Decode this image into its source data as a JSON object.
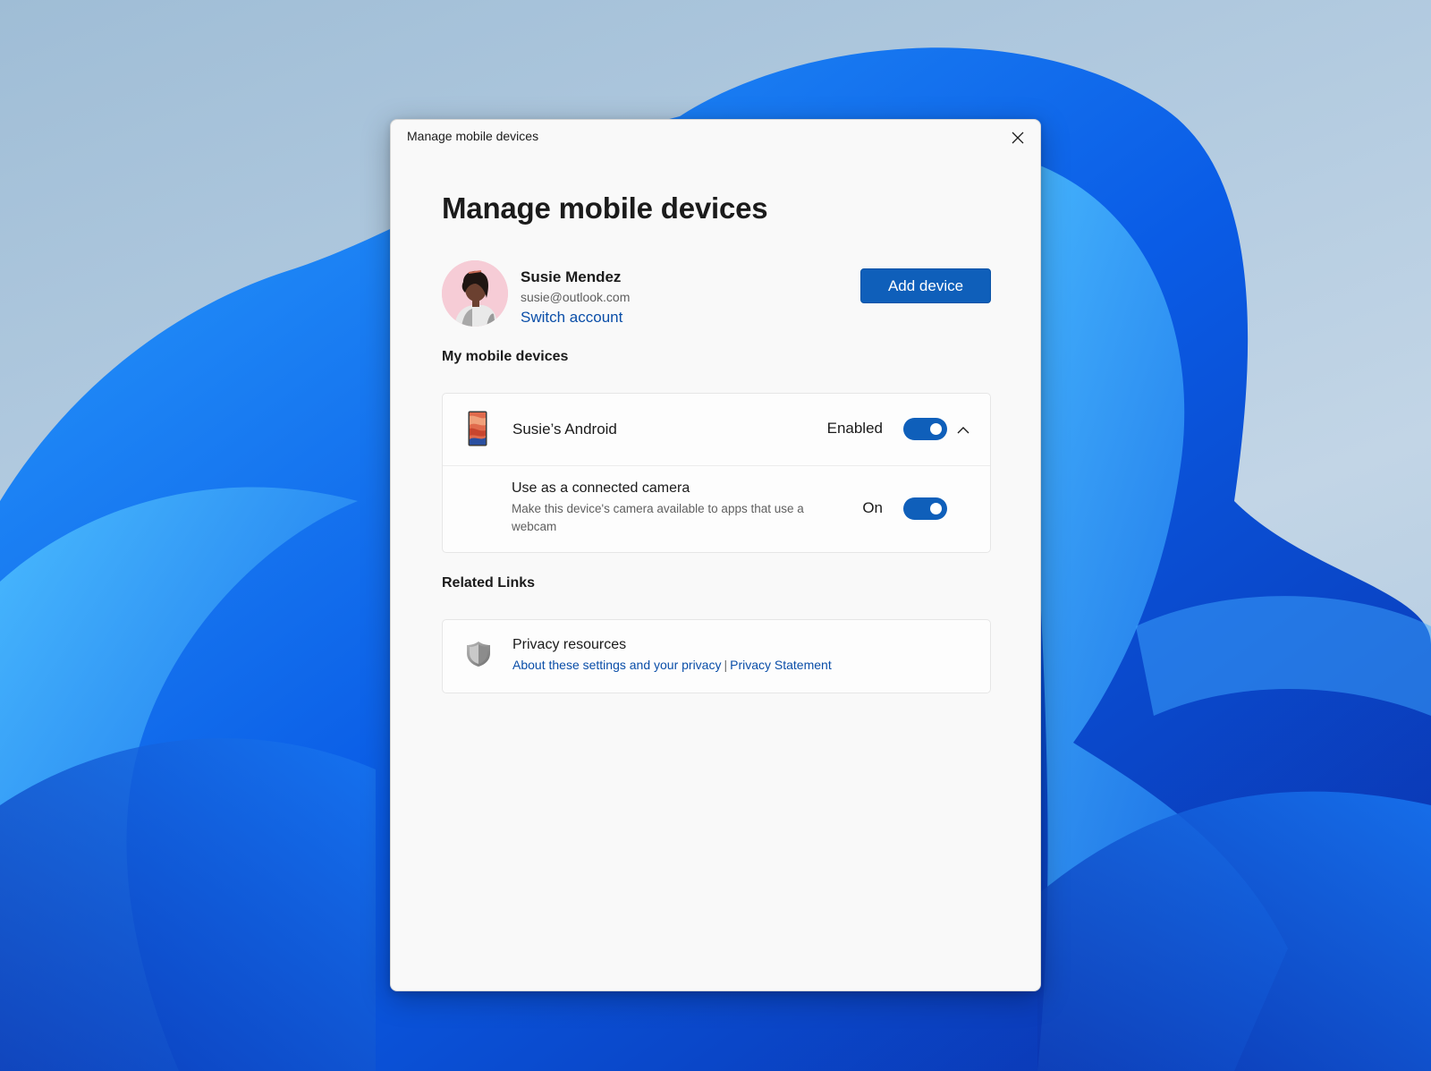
{
  "window": {
    "title": "Manage mobile devices",
    "close_icon": "close-icon"
  },
  "page": {
    "title": "Manage mobile devices"
  },
  "account": {
    "name": "Susie Mendez",
    "email": "susie@outlook.com",
    "switch_label": "Switch account",
    "avatar": "user-avatar-photo"
  },
  "add_device_label": "Add device",
  "devices_section": {
    "heading": "My mobile devices",
    "devices": [
      {
        "name": "Susie’s Android",
        "icon": "phone-icon",
        "state_label": "Enabled",
        "enabled": true,
        "expanded": true,
        "settings": [
          {
            "title": "Use as a connected camera",
            "description": "Make this device's camera available to apps that use a webcam",
            "state_label": "On",
            "on": true
          }
        ]
      }
    ]
  },
  "related_section": {
    "heading": "Related Links",
    "privacy": {
      "icon": "shield-icon",
      "title": "Privacy resources",
      "links": [
        {
          "label": "About these settings and your privacy"
        },
        {
          "label": "Privacy Statement"
        }
      ],
      "separator": "|"
    }
  },
  "colors": {
    "accent": "#0f5fba",
    "link": "#0a4ea8",
    "window_bg": "#f9f9f9",
    "card_bg": "#fdfdfd"
  }
}
